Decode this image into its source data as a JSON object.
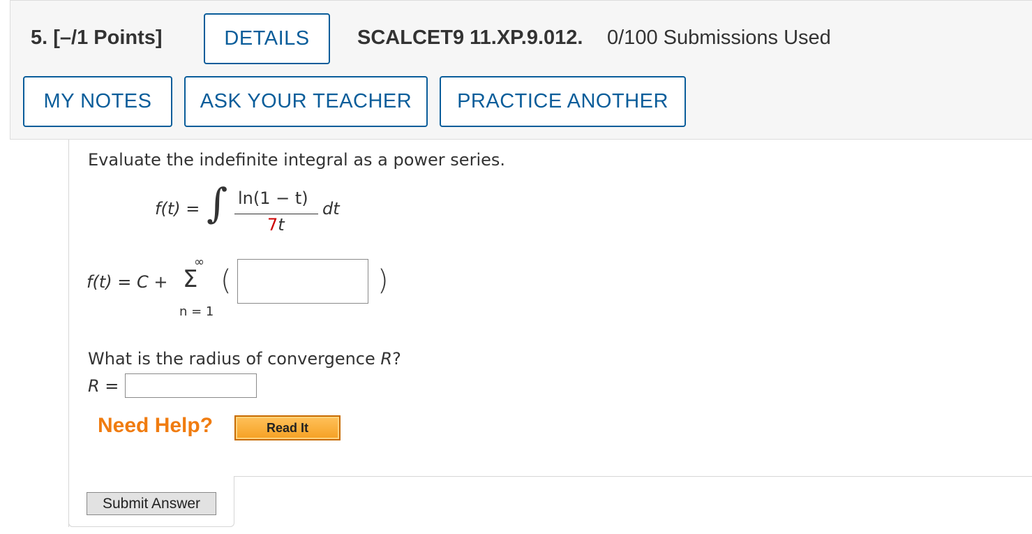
{
  "header": {
    "question_label": "5.  [–/1 Points]",
    "details_button": "DETAILS",
    "problem_code": "SCALCET9 11.XP.9.012.",
    "submissions": "0/100 Submissions Used",
    "my_notes_button": "MY NOTES",
    "ask_teacher_button": "ASK YOUR TEACHER",
    "practice_button": "PRACTICE ANOTHER"
  },
  "question": {
    "prompt": "Evaluate the indefinite integral as a power series.",
    "f_lhs": "f(t)  =",
    "integral_sign": "∫",
    "numerator": "ln(1 − t)",
    "denominator_coef": "7",
    "denominator_var": "t",
    "dt": "dt",
    "series_lhs": "f(t)  =  C +",
    "sum_upper": "∞",
    "sum_symbol": "Σ",
    "sum_lower": "n = 1",
    "paren_open": "(",
    "paren_close": ")",
    "series_answer_value": "",
    "radius_prompt_pre": "What is the radius of convergence ",
    "radius_var": "R",
    "radius_prompt_post": "?",
    "r_label": "R  =",
    "radius_answer_value": ""
  },
  "help": {
    "need_help": "Need Help?",
    "read_it_button": "Read It"
  },
  "submit_button": "Submit Answer",
  "colors": {
    "accent_blue": "#0a5d9a",
    "help_orange": "#f07c10",
    "highlight_red": "#cc0000"
  }
}
